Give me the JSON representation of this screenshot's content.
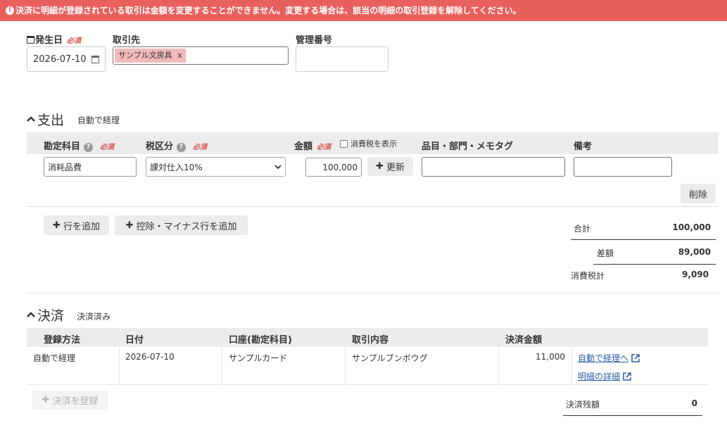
{
  "alert": {
    "message": "決済に明細が登録されている取引は金額を変更することができません。変更する場合は、該当の明細の取引登録を解除してください。"
  },
  "form": {
    "date_label": "発生日",
    "required_label": "必須",
    "date_value": "2026-07-10",
    "partner_label": "取引先",
    "partner_tag": "サンプル文房具",
    "partner_tag_remove": "x",
    "mgmt_label": "管理番号"
  },
  "expense": {
    "title": "支出",
    "subtitle": "自動で経理",
    "headers": {
      "account": "勘定科目",
      "tax": "税区分",
      "amount": "金額",
      "show_tax": "消費税を表示",
      "items": "品目・部門・メモタグ",
      "note": "備考"
    },
    "row": {
      "account": "消耗品費",
      "tax": "課対仕入10%",
      "amount": "100,000",
      "update_button": "更新",
      "delete_button": "削除"
    },
    "add_row_button": "行を追加",
    "add_minus_button": "控除・マイナス行を追加",
    "totals": {
      "total_label": "合計",
      "total_value": "100,000",
      "diff_label": "差額",
      "diff_value": "89,000",
      "tax_label": "消費税計",
      "tax_value": "9,090"
    }
  },
  "settlement": {
    "title": "決済",
    "subtitle": "決済済み",
    "headers": [
      "登録方法",
      "日付",
      "口座(勘定科目)",
      "取引内容",
      "決済金額"
    ],
    "row": {
      "method": "自動で経理",
      "date": "2026-07-10",
      "account": "サンプルカード",
      "content": "サンプルブンボウグ",
      "amount": "11,000",
      "link_auto": "自動で経理へ",
      "link_detail": "明細の詳細"
    },
    "register_button": "決済を登録",
    "balance_label": "決済残額",
    "balance_value": "0"
  },
  "colors": {
    "alert": "#e8605d",
    "required": "#d9534f",
    "link": "#2a5fa8",
    "tag": "#f2b9b9"
  }
}
